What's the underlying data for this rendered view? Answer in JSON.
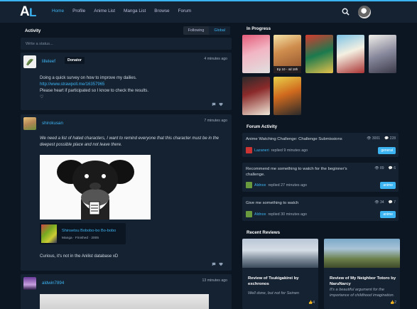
{
  "nav": {
    "logo": "AL",
    "items": [
      "Home",
      "Profile",
      "Anime List",
      "Manga List",
      "Browse",
      "Forum"
    ]
  },
  "activity": {
    "title": "Activity",
    "toggle": [
      "Following",
      "Global"
    ],
    "status_placeholder": "Write a status..."
  },
  "posts": [
    {
      "user": "lilleleef",
      "badge": "Donator",
      "time": "4 minutes ago",
      "lines": [
        "Doing a quick survey on how to improve my dailies.",
        "http://www.strawpoll.me/16357965",
        "Please heart if participated so I know to check the results."
      ],
      "emoji": "♡"
    },
    {
      "user": "shirokusan",
      "time": "7 minutes ago",
      "quote": "We need a list of hated characters, I want to remind everyone that this character must be in the deepest possible place and not leave there.",
      "media_title": "Shinsetsu Bobobo-bo Bo-bobo",
      "media_meta": "Manga · Finished · 2005",
      "comment": "Curious, it's not in the Anilist database xD"
    },
    {
      "user": "aldwin7894",
      "time": "13 minutes ago"
    }
  ],
  "in_progress": {
    "title": "In Progress",
    "episode_label": "Ep 10 - 4d 18h"
  },
  "forum": {
    "title": "Forum Activity",
    "threads": [
      {
        "title": "Anime Watching Challenge: Challenge Submissions",
        "views": "3001",
        "replies": "228",
        "user": "Lazaneri",
        "action": "replied 9 minutes ago",
        "tag": "general"
      },
      {
        "title": "Recommend me something to watch for the beginner's challenge.",
        "views": "89",
        "replies": "6",
        "user": "Aldnox",
        "action": "replied 27 minutes ago",
        "tag": "anime"
      },
      {
        "title": "Give me something to watch",
        "views": "34",
        "replies": "7",
        "user": "Aldnox",
        "action": "replied 30 minutes ago",
        "tag": "anime"
      }
    ]
  },
  "reviews": {
    "title": "Recent Reviews",
    "items": [
      {
        "title": "Review of Tsukigakirei by exchronos",
        "summary": "Well done, but not for Seinen",
        "likes": "4"
      },
      {
        "title": "Review of My Neighbor Totoro by NaruNarcy",
        "summary": "It's a beautiful argument for the importance of childhood imagination.",
        "likes": "2"
      }
    ]
  },
  "colors": {
    "accent": "#3db4f2",
    "bg": "#0b1622",
    "panel": "#152232"
  }
}
